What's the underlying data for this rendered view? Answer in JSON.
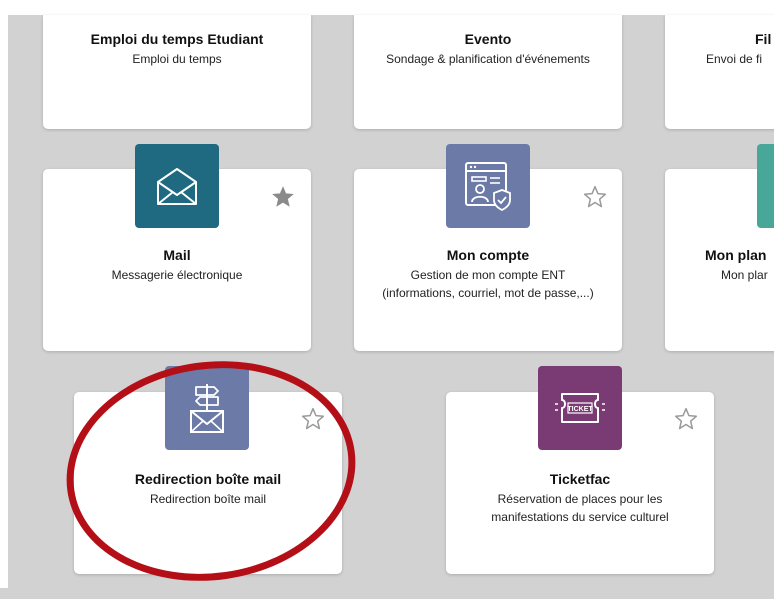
{
  "cards": [
    {
      "title": "Emploi du temps Etudiant",
      "desc": "Emploi du temps"
    },
    {
      "title": "Evento",
      "desc": "Sondage & planification d'événements"
    },
    {
      "title": "Fil",
      "desc": "Envoi de fi"
    },
    {
      "title": "Mail",
      "desc": "Messagerie électronique",
      "favorite": true
    },
    {
      "title": "Mon compte",
      "desc": "Gestion de mon compte ENT",
      "desc2": "(informations, courriel, mot de passe,...)",
      "favorite": false
    },
    {
      "title": "Mon plan",
      "desc": "Mon plar"
    },
    {
      "title": "Redirection boîte mail",
      "desc": "Redirection boîte mail",
      "favorite": false
    },
    {
      "title": "Ticketfac",
      "desc": "Réservation de places pour les",
      "desc2": "manifestations du service culturel",
      "favorite": false
    }
  ],
  "ticket_label": "TICKET",
  "colors": {
    "mail": "#1f6a80",
    "mon_compte": "#6b7aa6",
    "redirection": "#6b7aa6",
    "ticketfac": "#7a3a73",
    "mon_plan": "#49a79a",
    "annotation_ring": "#b40e16",
    "star_filled": "#8a8a8a"
  }
}
